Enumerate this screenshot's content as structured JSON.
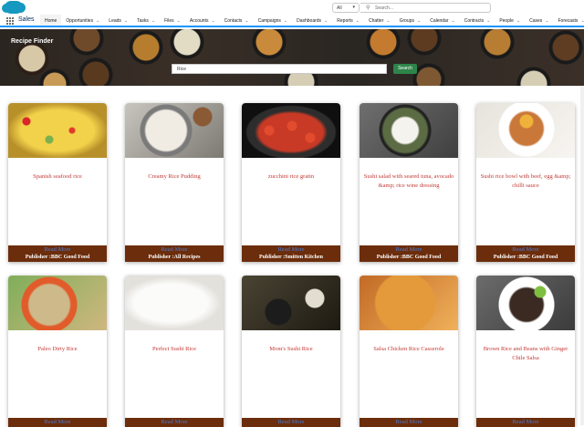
{
  "header": {
    "search_scope": "All",
    "search_placeholder": "Search..."
  },
  "nav": {
    "app_name": "Sales",
    "tabs": [
      {
        "label": "Home",
        "active": true
      },
      {
        "label": "Opportunities"
      },
      {
        "label": "Leads"
      },
      {
        "label": "Tasks"
      },
      {
        "label": "Files"
      },
      {
        "label": "Accounts"
      },
      {
        "label": "Contacts"
      },
      {
        "label": "Campaigns"
      },
      {
        "label": "Dashboards"
      },
      {
        "label": "Reports"
      },
      {
        "label": "Chatter"
      },
      {
        "label": "Groups"
      },
      {
        "label": "Calendar"
      },
      {
        "label": "Contracts"
      },
      {
        "label": "People"
      },
      {
        "label": "Cases"
      },
      {
        "label": "Forecasts"
      },
      {
        "label": "Accoun"
      }
    ]
  },
  "recipe_finder": {
    "title": "Recipe Finder",
    "query": "Rice",
    "search_button": "Search"
  },
  "recipes": [
    {
      "title": "Spanish seafood rice",
      "read_more": "Read More",
      "publisher": "Publisher :BBC Good Food",
      "image": "spanish-seafood-rice-photo"
    },
    {
      "title": "Creamy Rice Pudding",
      "read_more": "Read More",
      "publisher": "Publisher :All Recipes",
      "image": "creamy-rice-pudding-photo"
    },
    {
      "title": "zucchini rice gratin",
      "read_more": "Read More",
      "publisher": "Publisher :Smitten Kitchen",
      "image": "zucchini-rice-gratin-photo"
    },
    {
      "title": "Sushi salad with seared tuna, avocado &amp; rice wine dressing",
      "read_more": "Read More",
      "publisher": "Publisher :BBC Good Food",
      "image": "sushi-salad-photo"
    },
    {
      "title": "Sushi rice bowl with beef, egg &amp; chilli sauce",
      "read_more": "Read More",
      "publisher": "Publisher :BBC Good Food",
      "image": "sushi-rice-bowl-photo"
    },
    {
      "title": "Paleo Dirty Rice",
      "read_more": "Read More",
      "image": "paleo-dirty-rice-photo"
    },
    {
      "title": "Perfect Sushi Rice",
      "read_more": "Read More",
      "image": "perfect-sushi-rice-photo"
    },
    {
      "title": "Mom's Sushi Rice",
      "read_more": "Read More",
      "image": "moms-sushi-rice-photo"
    },
    {
      "title": "Salsa Chicken Rice Casserole",
      "read_more": "Read More",
      "image": "salsa-chicken-casserole-photo"
    },
    {
      "title": "Brown Rice and Beans with Ginger Chile Salsa",
      "read_more": "Read More",
      "image": "brown-rice-beans-photo"
    }
  ]
}
